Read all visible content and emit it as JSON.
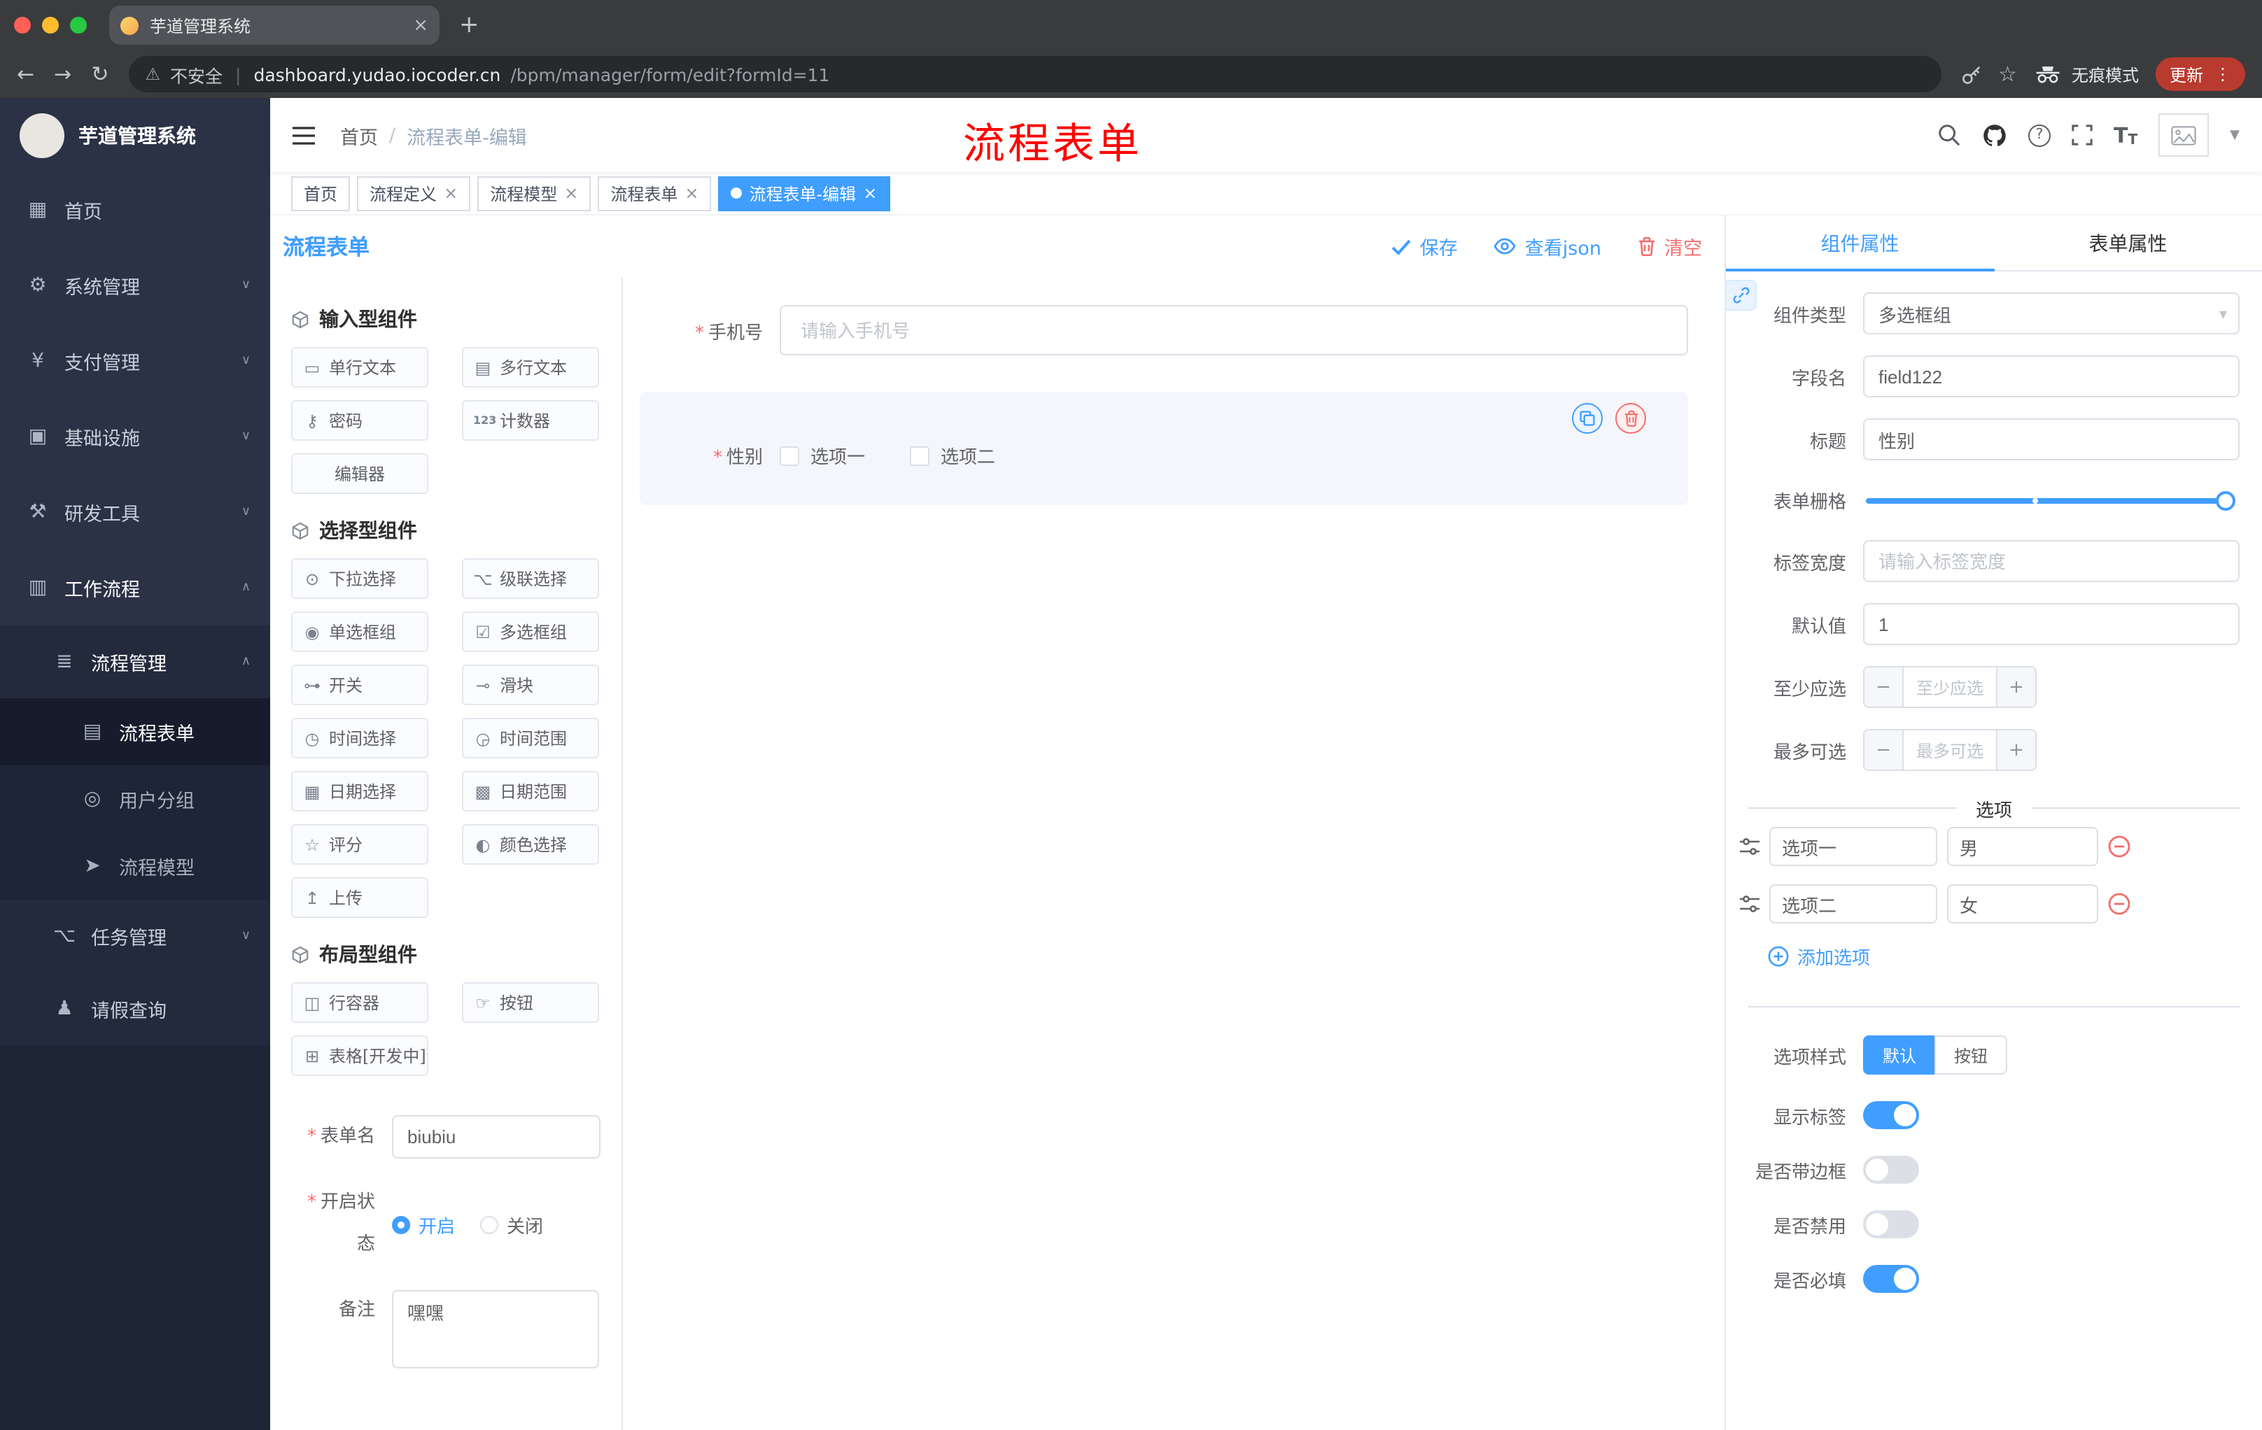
{
  "browser": {
    "tab_title": "芋道管理系统",
    "security_label": "不安全",
    "url_host": "dashboard.yudao.iocoder.cn",
    "url_path": "/bpm/manager/form/edit?formId=11",
    "incognito_label": "无痕模式",
    "update_label": "更新"
  },
  "sidebar": {
    "logo_title": "芋道管理系统",
    "items": [
      {
        "label": "首页"
      },
      {
        "label": "系统管理"
      },
      {
        "label": "支付管理"
      },
      {
        "label": "基础设施"
      },
      {
        "label": "研发工具"
      },
      {
        "label": "工作流程"
      },
      {
        "label": "流程管理"
      },
      {
        "label": "流程表单"
      },
      {
        "label": "用户分组"
      },
      {
        "label": "流程模型"
      },
      {
        "label": "任务管理"
      },
      {
        "label": "请假查询"
      }
    ]
  },
  "header": {
    "breadcrumb_home": "首页",
    "breadcrumb_current": "流程表单-编辑",
    "annotation": "流程表单"
  },
  "tags": [
    {
      "label": "首页",
      "closable": false,
      "active": false
    },
    {
      "label": "流程定义",
      "closable": true,
      "active": false
    },
    {
      "label": "流程模型",
      "closable": true,
      "active": false
    },
    {
      "label": "流程表单",
      "closable": true,
      "active": false
    },
    {
      "label": "流程表单-编辑",
      "closable": true,
      "active": true
    }
  ],
  "designer": {
    "panel_title": "流程表单",
    "save_label": "保存",
    "view_json_label": "查看json",
    "clear_label": "清空"
  },
  "palette": {
    "sections": [
      {
        "title": "输入型组件"
      },
      {
        "title": "选择型组件"
      },
      {
        "title": "布局型组件"
      }
    ],
    "input_items": [
      "单行文本",
      "多行文本",
      "密码",
      "计数器",
      "编辑器"
    ],
    "select_items": [
      "下拉选择",
      "级联选择",
      "单选框组",
      "多选框组",
      "开关",
      "滑块",
      "时间选择",
      "时间范围",
      "日期选择",
      "日期范围",
      "评分",
      "颜色选择",
      "上传"
    ],
    "layout_items": [
      "行容器",
      "按钮",
      "表格[开发中]"
    ]
  },
  "form_meta": {
    "name_label": "表单名",
    "name_value": "biubiu",
    "status_label": "开启状态",
    "status_on": "开启",
    "status_off": "关闭",
    "remark_label": "备注",
    "remark_value": "嘿嘿"
  },
  "canvas": {
    "phone_label": "手机号",
    "phone_placeholder": "请输入手机号",
    "gender_label": "性别",
    "gender_opt1": "选项一",
    "gender_opt2": "选项二"
  },
  "props": {
    "tab_component": "组件属性",
    "tab_form": "表单属性",
    "type_label": "组件类型",
    "type_value": "多选框组",
    "field_label": "字段名",
    "field_value": "field122",
    "title_label": "标题",
    "title_value": "性别",
    "grid_label": "表单栅格",
    "width_label": "标签宽度",
    "width_placeholder": "请输入标签宽度",
    "default_label": "默认值",
    "default_value": "1",
    "min_label": "至少应选",
    "min_placeholder": "至少应选",
    "max_label": "最多可选",
    "max_placeholder": "最多可选",
    "options_title": "选项",
    "options": [
      {
        "label": "选项一",
        "value": "男"
      },
      {
        "label": "选项二",
        "value": "女"
      }
    ],
    "add_option_label": "添加选项",
    "style_label": "选项样式",
    "style_default": "默认",
    "style_button": "按钮",
    "switch_show_label": "显示标签",
    "switch_border": "是否带边框",
    "switch_disabled": "是否禁用",
    "switch_required": "是否必填"
  },
  "colors": {
    "accent": "#409eff",
    "danger": "#f56c6c"
  }
}
